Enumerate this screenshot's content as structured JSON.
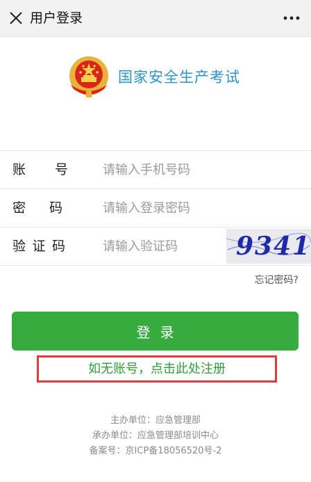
{
  "header": {
    "title": "用户登录",
    "close_icon": "close-icon",
    "more_icon": "more-icon"
  },
  "brand": {
    "name": "国家安全生产考试",
    "color": "#2a93c9",
    "emblem_icon": "national-emblem-icon"
  },
  "form": {
    "account": {
      "label_chars": [
        "账",
        "号"
      ],
      "placeholder": "请输入手机号码"
    },
    "password": {
      "label_chars": [
        "密",
        "码"
      ],
      "placeholder": "请输入登录密码"
    },
    "captcha": {
      "label_chars": [
        "验",
        "证",
        "码"
      ],
      "placeholder": "请输入验证码",
      "image_text": "9341"
    },
    "forgot_label": "忘记密码?"
  },
  "actions": {
    "login_label": "登录",
    "login_color": "#35ac3d",
    "register_label": "如无账号，点击此处注册",
    "register_color": "#2f9d3a",
    "highlight_color": "#e23a3a"
  },
  "footer": {
    "lines": [
      "主办单位：应急管理部",
      "承办单位：应急管理部培训中心",
      "备案号：京ICP备18056520号-2"
    ]
  }
}
